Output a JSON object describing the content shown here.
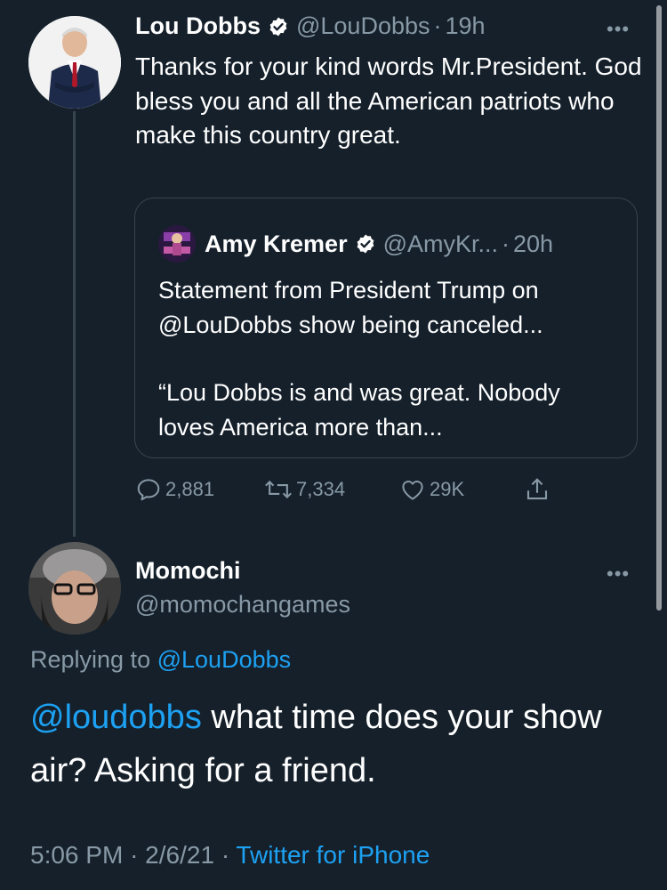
{
  "colors": {
    "background": "#15202b",
    "secondary_text": "#8899a6",
    "link": "#1da1f2",
    "border": "#38444d",
    "verified_badge": "#ffffff"
  },
  "tweet": {
    "author_name": "Lou Dobbs",
    "author_handle": "@LouDobbs",
    "time_ago": "19h",
    "separator": "·",
    "more_label": "•••",
    "text": "Thanks for your kind words Mr.President. God bless you and all the American patriots who make this country great.",
    "quote": {
      "author_name": "Amy Kremer",
      "author_handle": "@AmyKr...",
      "time_ago": "20h",
      "line1": "Statement from President Trump on @LouDobbs show being canceled...",
      "line2": "“Lou Dobbs is and was great. Nobody loves America more than..."
    },
    "actions": {
      "replies": "2,881",
      "retweets": "7,334",
      "likes": "29K",
      "icons": [
        "reply-icon",
        "retweet-icon",
        "like-icon",
        "share-icon"
      ]
    }
  },
  "reply": {
    "author_name": "Momochi",
    "author_handle": "@momochangames",
    "more_label": "•••",
    "replying_prefix": "Replying to",
    "replying_to": "@LouDobbs",
    "mention": "@loudobbs",
    "text": " what time does your show air? Asking for a friend.",
    "time": "5:06 PM",
    "date": "2/6/21",
    "separator": "·",
    "source": "Twitter for iPhone"
  }
}
